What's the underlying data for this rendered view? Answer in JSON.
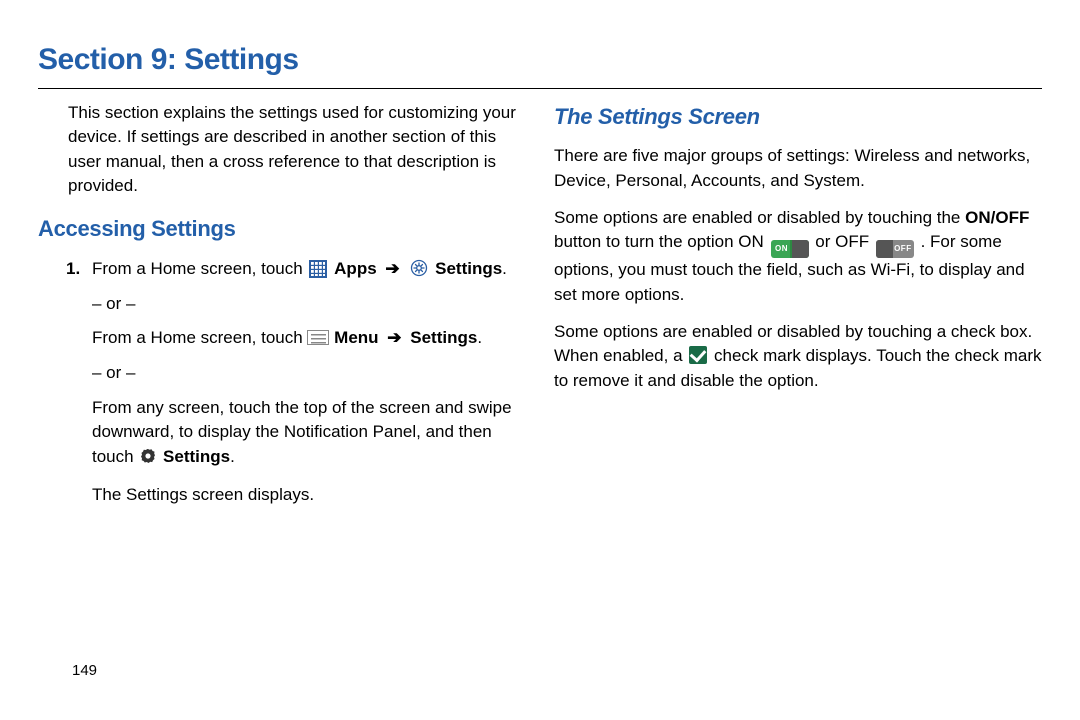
{
  "header": {
    "title": "Section 9: Settings"
  },
  "left": {
    "intro": "This section explains the settings used for customizing your device. If settings are described in another section of this user manual, then a cross reference to that description is provided.",
    "h_accessing": "Accessing Settings",
    "step1_num": "1.",
    "step1_a": "From a Home screen, touch ",
    "apps_label": "Apps",
    "settings_label": "Settings",
    "period": ".",
    "or": "– or –",
    "step1_b": "From a Home screen, touch ",
    "menu_label": "Menu",
    "step1_c": "From any screen, touch the top of the screen and swipe downward, to display the Notification Panel, and then touch ",
    "step1_end": "The Settings screen displays."
  },
  "right": {
    "h_screen": "The Settings Screen",
    "p1": "There are five major groups of settings: Wireless and networks, Device, Personal, Accounts, and System.",
    "p2a": "Some options are enabled or disabled by touching the ",
    "onoff": "ON/OFF",
    "p2b": " button to turn the option ON ",
    "p2c": " or OFF ",
    "p2d": ". For some options, you must touch the field, such as Wi-Fi, to display and set more options.",
    "p3a": "Some options are enabled or disabled by touching a check box. When enabled, a ",
    "p3b": " check mark displays. Touch the check mark to remove it and disable the option.",
    "toggle_on": "ON",
    "toggle_off": "OFF"
  },
  "page_number": "149"
}
